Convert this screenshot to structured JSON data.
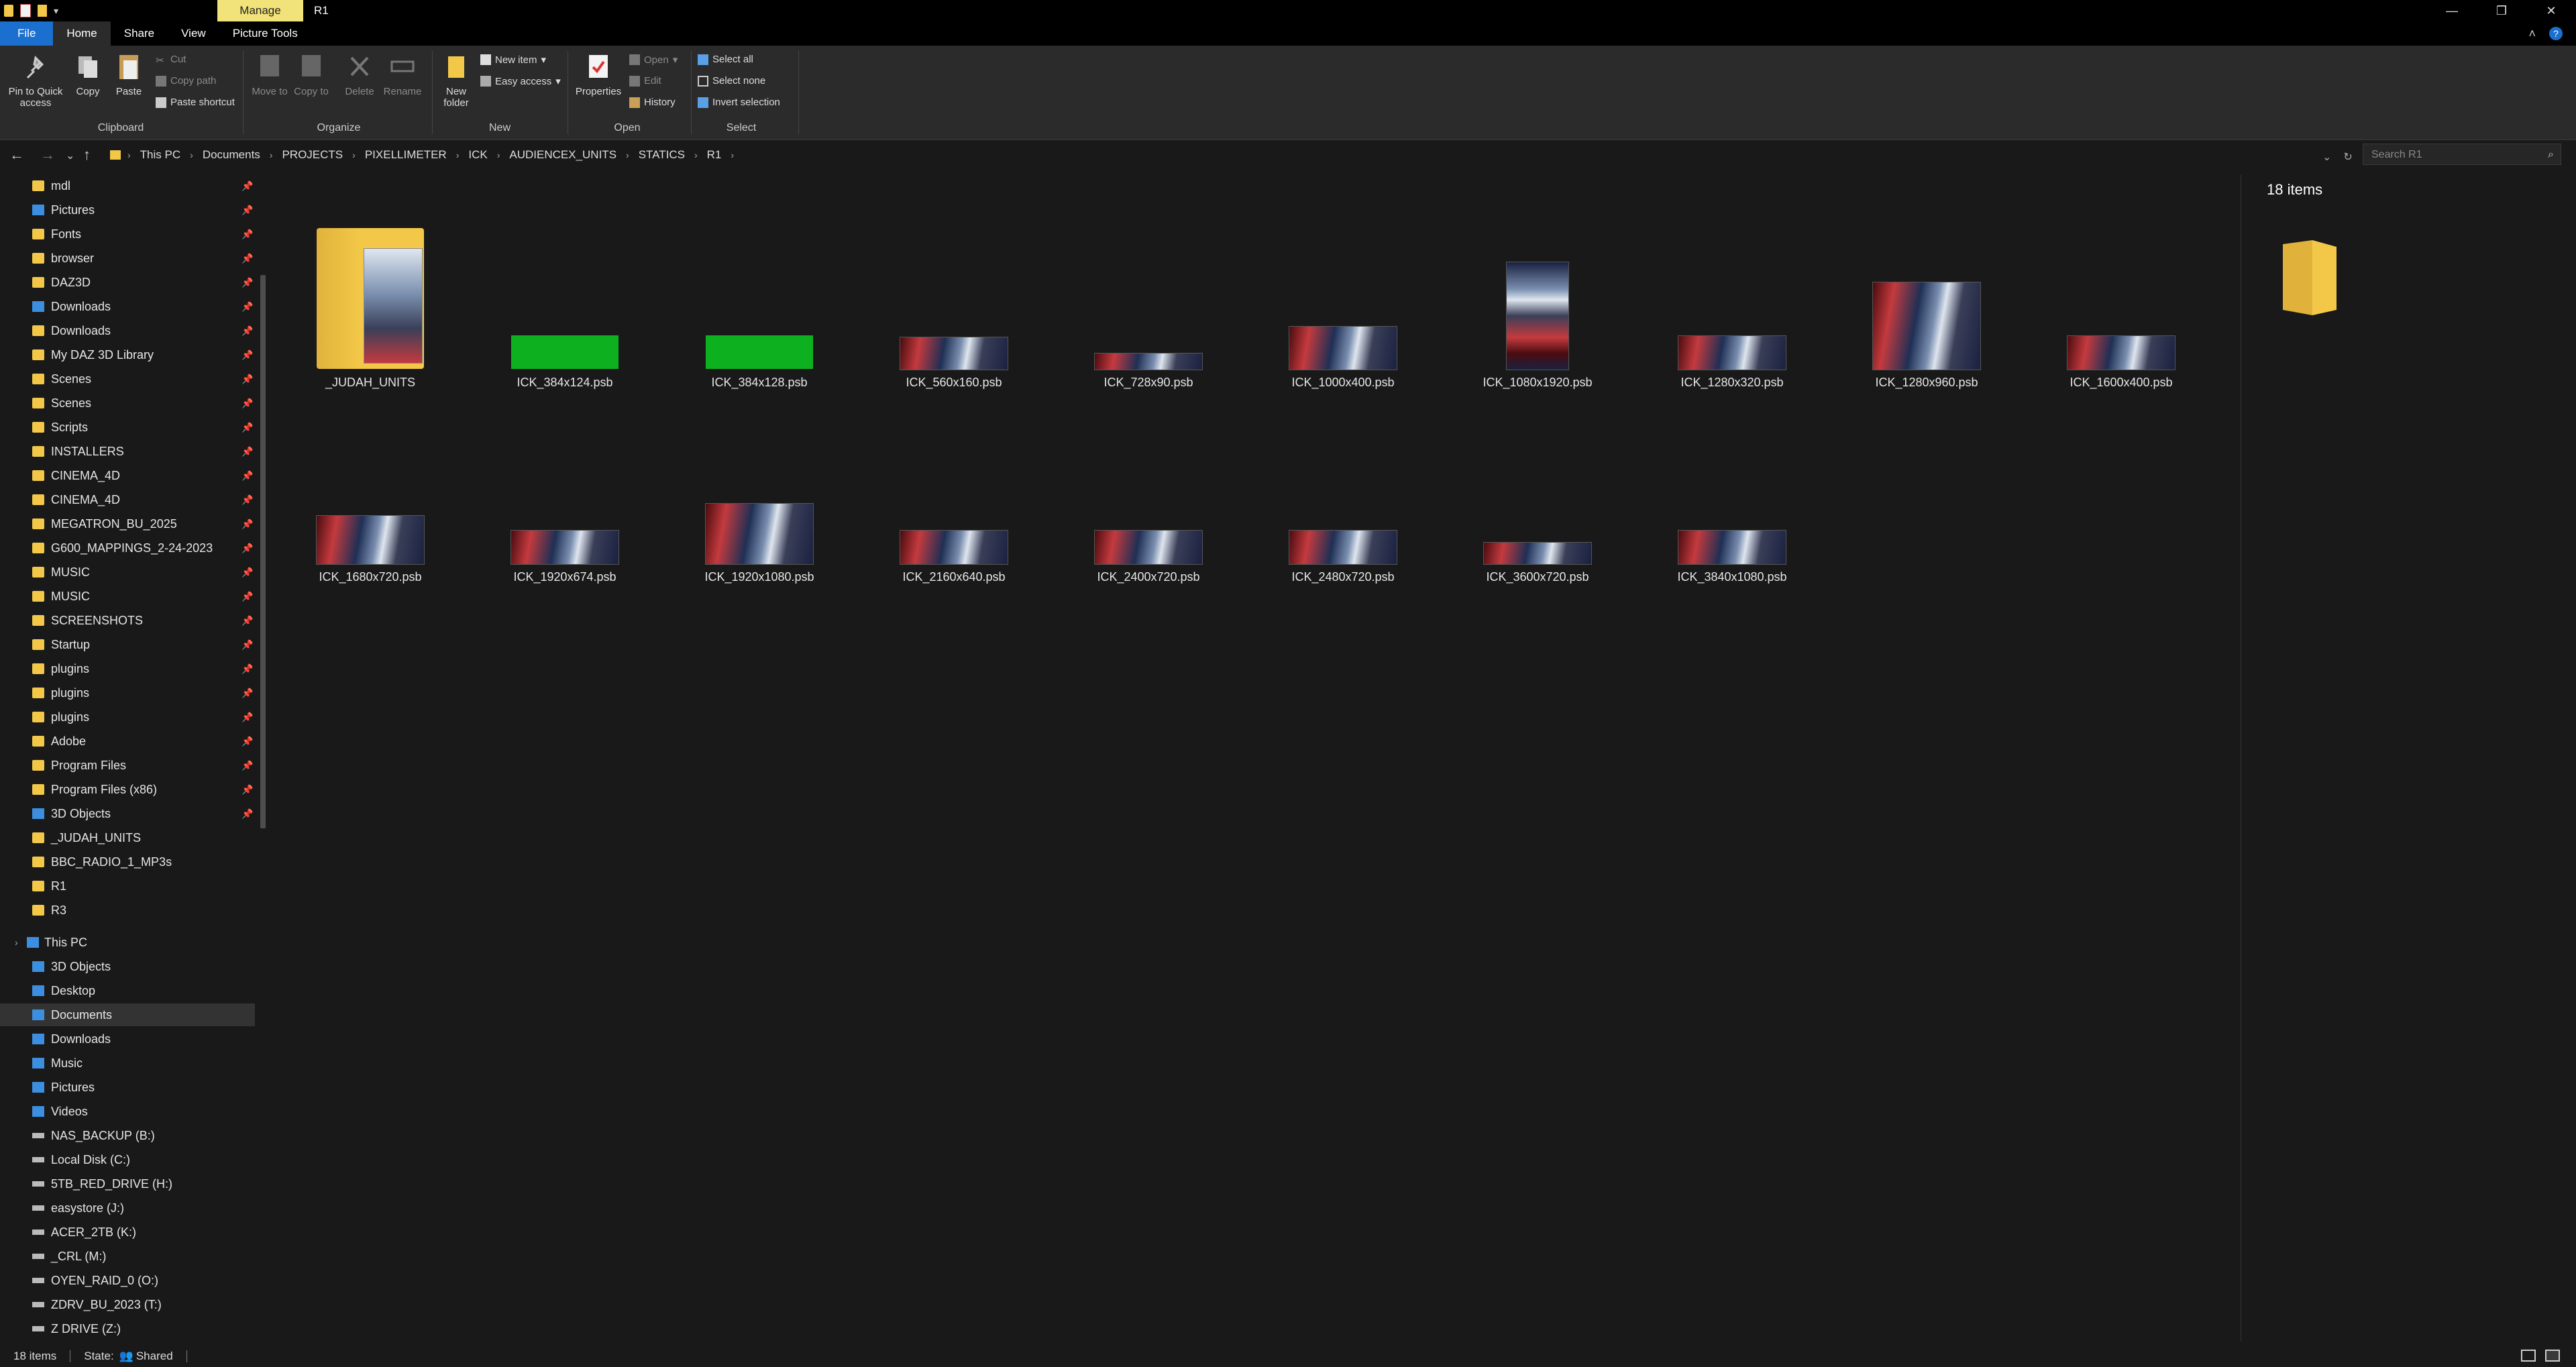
{
  "window": {
    "title": "R1",
    "context_tab": "Manage"
  },
  "ribbon_tabs": [
    "File",
    "Home",
    "Share",
    "View",
    "Picture Tools"
  ],
  "ribbon": {
    "clipboard": {
      "label": "Clipboard",
      "pin": "Pin to Quick access",
      "copy": "Copy",
      "paste": "Paste",
      "cut": "Cut",
      "copy_path": "Copy path",
      "paste_shortcut": "Paste shortcut"
    },
    "organize": {
      "label": "Organize",
      "move_to": "Move to",
      "copy_to": "Copy to",
      "delete": "Delete",
      "rename": "Rename"
    },
    "new": {
      "label": "New",
      "new_folder": "New folder",
      "new_item": "New item",
      "easy_access": "Easy access"
    },
    "open": {
      "label": "Open",
      "properties": "Properties",
      "open": "Open",
      "edit": "Edit",
      "history": "History"
    },
    "select": {
      "label": "Select",
      "select_all": "Select all",
      "select_none": "Select none",
      "invert": "Invert selection"
    }
  },
  "address": {
    "crumbs": [
      "This PC",
      "Documents",
      "PROJECTS",
      "PIXELLIMETER",
      "ICK",
      "AUDIENCEX_UNITS",
      "STATICS",
      "R1"
    ],
    "search_placeholder": "Search R1"
  },
  "sidebar": {
    "quick_access": [
      {
        "label": "mdl",
        "icon": "folder-icon"
      },
      {
        "label": "Pictures",
        "icon": "pictures-icon"
      },
      {
        "label": "Fonts",
        "icon": "folder-icon"
      },
      {
        "label": "browser",
        "icon": "folder-icon"
      },
      {
        "label": "DAZ3D",
        "icon": "folder-icon"
      },
      {
        "label": "Downloads",
        "icon": "downloads-icon"
      },
      {
        "label": "Downloads",
        "icon": "folder-icon"
      },
      {
        "label": "My DAZ 3D Library",
        "icon": "folder-icon"
      },
      {
        "label": "Scenes",
        "icon": "folder-icon"
      },
      {
        "label": "Scenes",
        "icon": "folder-icon"
      },
      {
        "label": "Scripts",
        "icon": "folder-icon"
      },
      {
        "label": "INSTALLERS",
        "icon": "folder-icon"
      },
      {
        "label": "CINEMA_4D",
        "icon": "folder-icon"
      },
      {
        "label": "CINEMA_4D",
        "icon": "folder-icon"
      },
      {
        "label": "MEGATRON_BU_2025",
        "icon": "folder-icon"
      },
      {
        "label": "G600_MAPPINGS_2-24-2023",
        "icon": "folder-icon"
      },
      {
        "label": "MUSIC",
        "icon": "folder-icon"
      },
      {
        "label": "MUSIC",
        "icon": "folder-icon"
      },
      {
        "label": "SCREENSHOTS",
        "icon": "folder-icon"
      },
      {
        "label": "Startup",
        "icon": "folder-icon"
      },
      {
        "label": "plugins",
        "icon": "folder-icon"
      },
      {
        "label": "plugins",
        "icon": "folder-icon"
      },
      {
        "label": "plugins",
        "icon": "folder-icon"
      },
      {
        "label": "Adobe",
        "icon": "folder-icon"
      },
      {
        "label": "Program Files",
        "icon": "folder-icon"
      },
      {
        "label": "Program Files (x86)",
        "icon": "folder-icon"
      },
      {
        "label": "3D Objects",
        "icon": "3d-objects-icon"
      },
      {
        "label": "_JUDAH_UNITS",
        "icon": "folder-icon"
      },
      {
        "label": "BBC_RADIO_1_MP3s",
        "icon": "folder-icon"
      },
      {
        "label": "R1",
        "icon": "folder-icon"
      },
      {
        "label": "R3",
        "icon": "folder-icon"
      }
    ],
    "this_pc_label": "This PC",
    "this_pc": [
      {
        "label": "3D Objects",
        "icon": "3d-objects-icon"
      },
      {
        "label": "Desktop",
        "icon": "desktop-icon"
      },
      {
        "label": "Documents",
        "icon": "documents-icon"
      },
      {
        "label": "Downloads",
        "icon": "downloads-icon"
      },
      {
        "label": "Music",
        "icon": "music-icon"
      },
      {
        "label": "Pictures",
        "icon": "pictures-icon"
      },
      {
        "label": "Videos",
        "icon": "videos-icon"
      },
      {
        "label": "NAS_BACKUP (B:)",
        "icon": "drive-icon"
      },
      {
        "label": "Local Disk (C:)",
        "icon": "drive-icon"
      },
      {
        "label": "5TB_RED_DRIVE (H:)",
        "icon": "drive-icon"
      },
      {
        "label": "easystore (J:)",
        "icon": "drive-icon"
      },
      {
        "label": "ACER_2TB (K:)",
        "icon": "drive-icon"
      },
      {
        "label": "_CRL (M:)",
        "icon": "drive-icon"
      },
      {
        "label": "OYEN_RAID_0 (O:)",
        "icon": "drive-icon"
      },
      {
        "label": "ZDRV_BU_2023 (T:)",
        "icon": "drive-icon"
      },
      {
        "label": "Z DRIVE (Z:)",
        "icon": "drive-icon"
      }
    ],
    "selected": "Documents"
  },
  "files": [
    {
      "name": "_JUDAH_UNITS",
      "kind": "folder"
    },
    {
      "name": "ICK_384x124.psb",
      "kind": "green"
    },
    {
      "name": "ICK_384x128.psb",
      "kind": "green"
    },
    {
      "name": "ICK_560x160.psb",
      "kind": "art"
    },
    {
      "name": "ICK_728x90.psb",
      "kind": "art"
    },
    {
      "name": "ICK_1000x400.psb",
      "kind": "art"
    },
    {
      "name": "ICK_1080x1920.psb",
      "kind": "art-tall"
    },
    {
      "name": "ICK_1280x320.psb",
      "kind": "art"
    },
    {
      "name": "ICK_1280x960.psb",
      "kind": "art"
    },
    {
      "name": "ICK_1600x400.psb",
      "kind": "art"
    },
    {
      "name": "ICK_1680x720.psb",
      "kind": "art"
    },
    {
      "name": "ICK_1920x674.psb",
      "kind": "art"
    },
    {
      "name": "ICK_1920x1080.psb",
      "kind": "art"
    },
    {
      "name": "ICK_2160x640.psb",
      "kind": "art"
    },
    {
      "name": "ICK_2400x720.psb",
      "kind": "art"
    },
    {
      "name": "ICK_2480x720.psb",
      "kind": "art"
    },
    {
      "name": "ICK_3600x720.psb",
      "kind": "art"
    },
    {
      "name": "ICK_3840x1080.psb",
      "kind": "art"
    }
  ],
  "preview": {
    "count_label": "18 items"
  },
  "status": {
    "items": "18 items",
    "state": "State:",
    "shared": "Shared"
  },
  "colors": {
    "accent": "#1a6fcf",
    "folder": "#f3c848",
    "manage_tab": "#f2e27a",
    "green_thumb": "#0db120"
  }
}
